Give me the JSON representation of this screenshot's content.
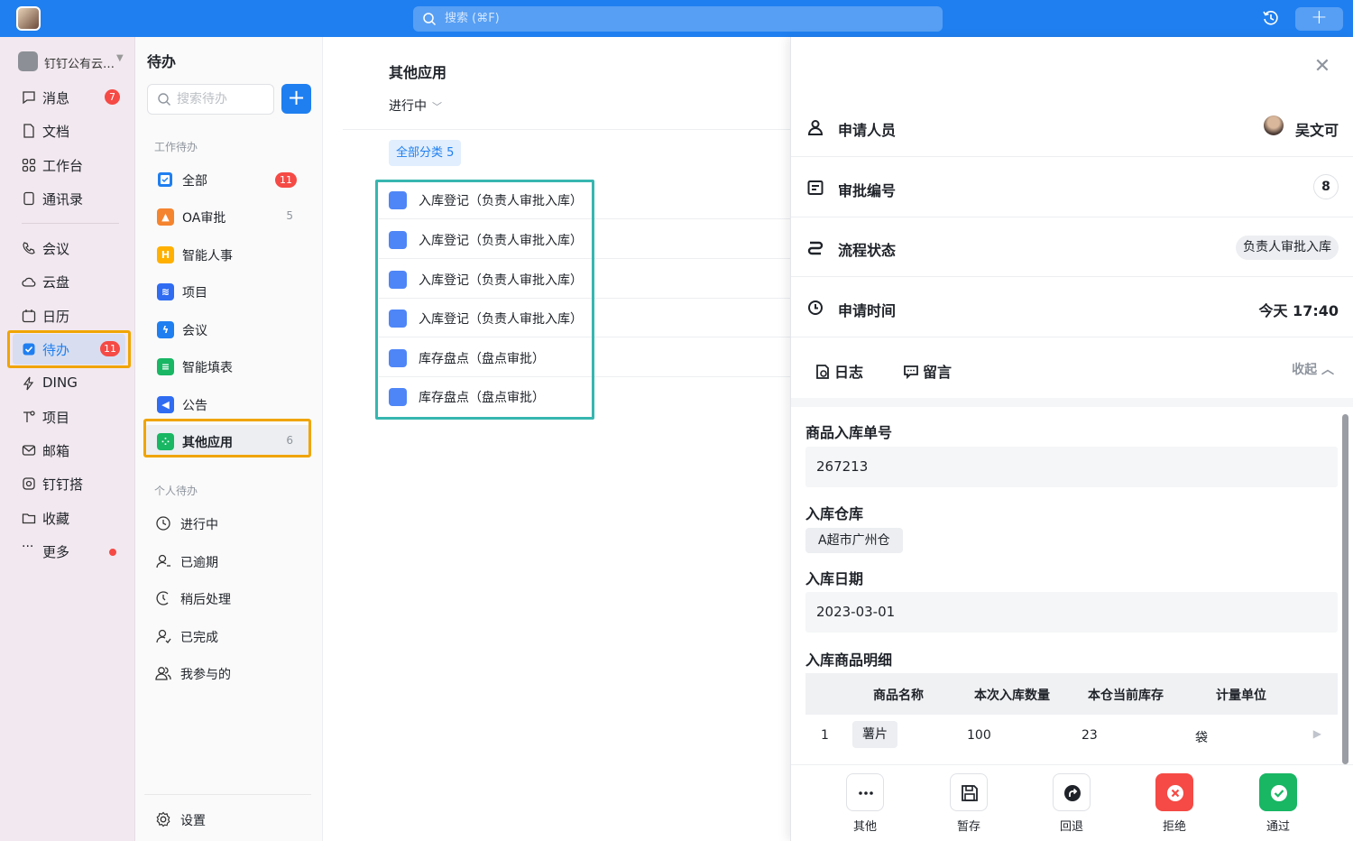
{
  "topbar": {
    "search_placeholder": "搜索 (⌘F)"
  },
  "leftnav": {
    "org_name": "钉钉公有云…",
    "items": [
      {
        "label": "消息",
        "badge": "7"
      },
      {
        "label": "文档"
      },
      {
        "label": "工作台"
      },
      {
        "label": "通讯录"
      },
      {
        "label": "会议"
      },
      {
        "label": "云盘"
      },
      {
        "label": "日历"
      },
      {
        "label": "待办",
        "badge": "11"
      },
      {
        "label": "DING"
      },
      {
        "label": "项目"
      },
      {
        "label": "邮箱"
      },
      {
        "label": "钉钉搭"
      },
      {
        "label": "收藏"
      },
      {
        "label": "更多"
      }
    ]
  },
  "todo": {
    "title": "待办",
    "search_placeholder": "搜索待办",
    "work_section": "工作待办",
    "work_items": [
      {
        "label": "全部",
        "badge": "11"
      },
      {
        "label": "OA审批",
        "count": "5"
      },
      {
        "label": "智能人事"
      },
      {
        "label": "项目"
      },
      {
        "label": "会议"
      },
      {
        "label": "智能填表"
      },
      {
        "label": "公告"
      },
      {
        "label": "其他应用",
        "count": "6"
      }
    ],
    "personal_section": "个人待办",
    "personal_items": [
      {
        "label": "进行中"
      },
      {
        "label": "已逾期"
      },
      {
        "label": "稍后处理"
      },
      {
        "label": "已完成"
      },
      {
        "label": "我参与的"
      }
    ],
    "settings_label": "设置"
  },
  "middle": {
    "title": "其他应用",
    "status_filter": "进行中",
    "category_tag": "全部分类 5",
    "rows": [
      "入库登记（负责人审批入库）",
      "入库登记（负责人审批入库）",
      "入库登记（负责人审批入库）",
      "入库登记（负责人审批入库）",
      "库存盘点（盘点审批）",
      "库存盘点（盘点审批）"
    ]
  },
  "detail": {
    "applicant_label": "申请人员",
    "applicant_name": "吴文可",
    "approval_no_label": "审批编号",
    "approval_no": "8",
    "process_status_label": "流程状态",
    "process_status": "负责人审批入库",
    "apply_time_label": "申请时间",
    "apply_time": "今天 17:40",
    "tab_log": "日志",
    "tab_comment": "留言",
    "collapse_label": "收起",
    "form": {
      "order_no_label": "商品入库单号",
      "order_no": "267213",
      "warehouse_label": "入库仓库",
      "warehouse": "A超市广州仓",
      "date_label": "入库日期",
      "date": "2023-03-01",
      "details_label": "入库商品明细",
      "table_headers": [
        "商品名称",
        "本次入库数量",
        "本仓当前库存",
        "计量单位"
      ],
      "table_rows": [
        {
          "index": "1",
          "name": "薯片",
          "qty": "100",
          "stock": "23",
          "unit": "袋"
        }
      ]
    },
    "actions": {
      "other": "其他",
      "save": "暂存",
      "return": "回退",
      "reject": "拒绝",
      "approve": "通过"
    }
  },
  "colors": {
    "brand_blue": "#1f7ff0",
    "badge_red": "#f54a45",
    "approve_green": "#19b664",
    "highlight_orange": "#f0a500",
    "highlight_teal": "#37b6b0"
  }
}
